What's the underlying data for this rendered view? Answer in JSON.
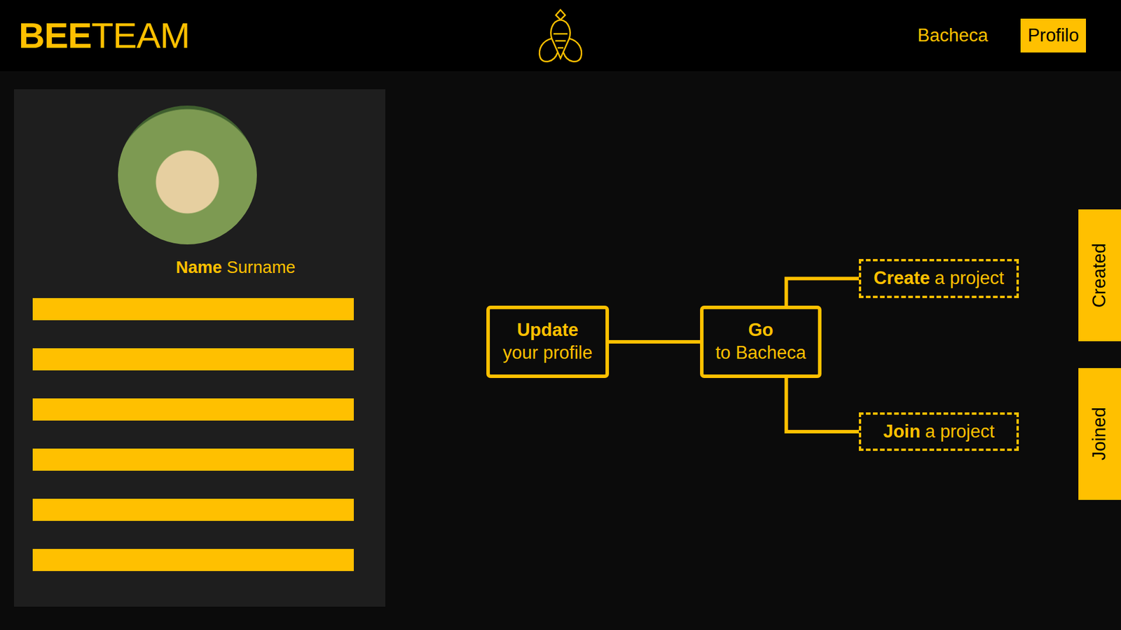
{
  "header": {
    "logo": {
      "bold": "BEE",
      "regular": "TEAM"
    },
    "nav": [
      {
        "label": "Bacheca",
        "selected": false
      },
      {
        "label": "Profilo",
        "selected": true
      }
    ]
  },
  "profile": {
    "name": "Name",
    "surname": "Surname",
    "fields": [
      "",
      "",
      "",
      "",
      "",
      ""
    ]
  },
  "diagram": {
    "nodes": [
      {
        "bold": "Update",
        "rest": "your profile",
        "kind": "step"
      },
      {
        "bold": "Go",
        "rest": "to Bacheca",
        "kind": "step"
      },
      {
        "bold": "Create",
        "rest": "a project",
        "kind": "option"
      },
      {
        "bold": "Join",
        "rest": "a project",
        "kind": "option"
      }
    ],
    "edges": [
      [
        0,
        1
      ],
      [
        1,
        2
      ],
      [
        1,
        3
      ]
    ]
  },
  "side_tabs": [
    {
      "label": "Created"
    },
    {
      "label": "Joined"
    }
  ]
}
